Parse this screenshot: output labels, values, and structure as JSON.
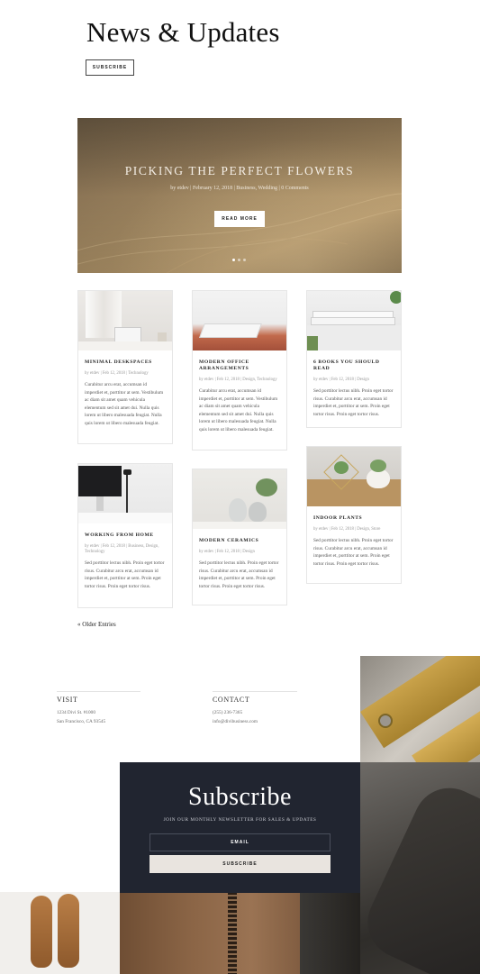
{
  "header": {
    "title": "News & Updates",
    "subscribe_label": "SUBSCRIBE"
  },
  "hero": {
    "title": "PICKING THE PERFECT FLOWERS",
    "meta": "by etdev | February 12, 2018 | Business, Wedding | 0 Comments",
    "button_label": "READ MORE",
    "slide_count": 3,
    "active_slide": 1
  },
  "posts": [
    {
      "title": "MINIMAL DESKSPACES",
      "meta": "by etdev | Feb 12, 2018 | Technology",
      "excerpt": "Curabitur arcu erat, accumsan id imperdiet et, porttitor at sem. Vestibulum ac diam sit amet quam vehicula elementum sed sit amet dui. Nulla quis lorem ut libero malesuada feugiat. Nulla quis lorem ut libero malesuada feugiat."
    },
    {
      "title": "MODERN OFFICE ARRANGEMENTS",
      "meta": "by etdev | Feb 12, 2018 | Design, Technology",
      "excerpt": "Curabitur arcu erat, accumsan id imperdiet et, porttitor at sem. Vestibulum ac diam sit amet quam vehicula elementum sed sit amet dui. Nulla quis lorem ut libero malesuada feugiat. Nulla quis lorem ut libero malesuada feugiat."
    },
    {
      "title": "6 BOOKS YOU SHOULD READ",
      "meta": "by etdev | Feb 12, 2018 | Design",
      "excerpt": "Sed porttitor lectus nibh. Proin eget tortor risus. Curabitur arcu erat, accumsan id imperdiet et, porttitor at sem. Proin eget tortor risus. Proin eget tortor risus."
    },
    {
      "title": "WORKING FROM HOME",
      "meta": "by etdev | Feb 12, 2018 | Business, Design, Technology",
      "excerpt": "Sed porttitor lectus nibh. Proin eget tortor risus. Curabitur arcu erat, accumsan id imperdiet et, porttitor at sem. Proin eget tortor risus. Proin eget tortor risus."
    },
    {
      "title": "MODERN CERAMICS",
      "meta": "by etdev | Feb 12, 2018 | Design",
      "excerpt": "Sed porttitor lectus nibh. Proin eget tortor risus. Curabitur arcu erat, accumsan id imperdiet et, porttitor at sem. Proin eget tortor risus. Proin eget tortor risus."
    },
    {
      "title": "INDOOR PLANTS",
      "meta": "by etdev | Feb 12, 2018 | Design, Store",
      "excerpt": "Sed porttitor lectus nibh. Proin eget tortor risus. Curabitur arcu erat, accumsan id imperdiet et, porttitor at sem. Proin eget tortor risus. Proin eget tortor risus."
    }
  ],
  "pagination": {
    "older_label": "« Older Entries"
  },
  "footer": {
    "visit": {
      "heading": "VISIT",
      "line1": "1234 Divi St. #1000",
      "line2": "San Francisco, CA 93545"
    },
    "contact": {
      "heading": "CONTACT",
      "line1": "(255) 236-7365",
      "line2": "info@divibusiness.com"
    }
  },
  "subscribe": {
    "title": "Subscribe",
    "subtitle": "JOIN OUR MONTHLY NEWSLETTER FOR SALES & UPDATES",
    "email_label": "EMAIL",
    "button_label": "SUBSCRIBE"
  },
  "colors": {
    "dark": "#212530",
    "button_light": "#e9e4df",
    "hero_tone": "#a58b63"
  }
}
